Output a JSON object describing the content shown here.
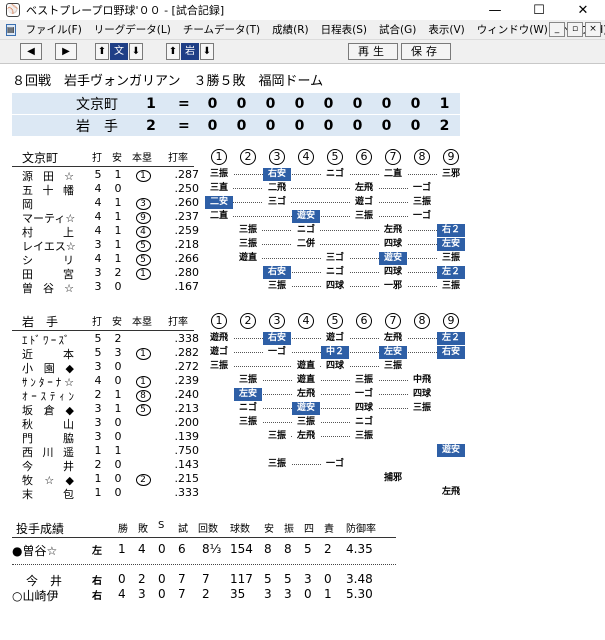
{
  "window": {
    "title": "ベストプレープロ野球'００ - [試合記録]",
    "controls": [
      "—",
      "☐",
      "✕"
    ]
  },
  "menu": {
    "items": [
      "ファイル(F)",
      "リーグデータ(L)",
      "チームデータ(T)",
      "成績(R)",
      "日程表(S)",
      "試合(G)",
      "表示(V)",
      "ウィンドウ(W)",
      "ヘルプ(H)"
    ],
    "mdi_controls": [
      "_",
      "▫",
      "×"
    ]
  },
  "toolbar": {
    "left_arrow": "◀",
    "right_arrow": "▶",
    "up1": "⬆",
    "team1": "文",
    "down1": "⬇",
    "up2": "⬆",
    "team2": "岩",
    "down2": "⬇",
    "replay": "再生",
    "save": "保存"
  },
  "game": {
    "title": "８回戦　岩手ヴォンガリアン　３勝５敗　福岡ドーム"
  },
  "scoreboard": [
    {
      "team": "文京町",
      "total": "1",
      "eq": "=",
      "innings": [
        "0",
        "0",
        "0",
        "0",
        "0",
        "0",
        "0",
        "0",
        "1"
      ]
    },
    {
      "team": "岩　手",
      "total": "2",
      "eq": "=",
      "innings": [
        "0",
        "0",
        "0",
        "0",
        "0",
        "0",
        "0",
        "0",
        "2"
      ]
    }
  ],
  "headers": {
    "ab": "打",
    "h": "安",
    "rbi": "本塁",
    "avg": "打率",
    "innings": [
      "1",
      "2",
      "3",
      "4",
      "5",
      "6",
      "7",
      "8",
      "9"
    ]
  },
  "visitor": {
    "team": "文京町",
    "batters": [
      {
        "name": "源田☆",
        "ab": "5",
        "h": "1",
        "rbi": "1",
        "avg": ".287",
        "cells": [
          [
            0,
            "三振",
            false
          ],
          [
            2,
            "右安",
            true
          ],
          [
            4,
            "ニゴ",
            false
          ],
          [
            6,
            "二直",
            false
          ],
          [
            8,
            "三邪",
            false
          ]
        ]
      },
      {
        "name": "五十幡",
        "ab": "4",
        "h": "0",
        "rbi": "",
        "avg": ".250",
        "cells": [
          [
            0,
            "三直",
            false
          ],
          [
            2,
            "二飛",
            false
          ],
          [
            5,
            "左飛",
            false
          ],
          [
            7,
            "一ゴ",
            false
          ]
        ]
      },
      {
        "name": "岡",
        "ab": "4",
        "h": "1",
        "rbi": "3",
        "avg": ".260",
        "cells": [
          [
            0,
            "二安",
            true
          ],
          [
            2,
            "三ゴ",
            false
          ],
          [
            5,
            "遊ゴ",
            false
          ],
          [
            7,
            "三振",
            false
          ]
        ]
      },
      {
        "name": "マーティ☆",
        "ab": "4",
        "h": "1",
        "rbi": "9",
        "avg": ".237",
        "cells": [
          [
            0,
            "二直",
            false
          ],
          [
            3,
            "遊安",
            true
          ],
          [
            5,
            "三振",
            false
          ],
          [
            7,
            "一ゴ",
            false
          ]
        ]
      },
      {
        "name": "村　上",
        "ab": "4",
        "h": "1",
        "rbi": "4",
        "avg": ".259",
        "cells": [
          [
            1,
            "三振",
            false
          ],
          [
            3,
            "ニゴ",
            false
          ],
          [
            6,
            "左飛",
            false
          ],
          [
            8,
            "右２",
            true
          ]
        ]
      },
      {
        "name": "レイエス☆",
        "ab": "3",
        "h": "1",
        "rbi": "5",
        "avg": ".218",
        "cells": [
          [
            1,
            "三振",
            false
          ],
          [
            3,
            "二併",
            false
          ],
          [
            6,
            "四球",
            false
          ],
          [
            8,
            "左安",
            true
          ]
        ]
      },
      {
        "name": "シ　リ",
        "ab": "4",
        "h": "1",
        "rbi": "5",
        "avg": ".266",
        "cells": [
          [
            1,
            "遊直",
            false
          ],
          [
            4,
            "三ゴ",
            false
          ],
          [
            6,
            "遊安",
            true
          ],
          [
            8,
            "三振",
            false
          ]
        ]
      },
      {
        "name": "田　宮",
        "ab": "3",
        "h": "2",
        "rbi": "1",
        "avg": ".280",
        "cells": [
          [
            2,
            "右安",
            true
          ],
          [
            4,
            "ニゴ",
            false
          ],
          [
            6,
            "四球",
            false
          ],
          [
            8,
            "左２",
            true
          ]
        ]
      },
      {
        "name": "曽谷☆",
        "ab": "3",
        "h": "0",
        "rbi": "",
        "avg": ".167",
        "cells": [
          [
            2,
            "三振",
            false
          ],
          [
            4,
            "四球",
            false
          ],
          [
            6,
            "一邪",
            false
          ],
          [
            8,
            "三振",
            false
          ]
        ]
      }
    ]
  },
  "home": {
    "team": "岩　手",
    "batters": [
      {
        "name": "ｴﾄﾞﾜｰｽﾞ",
        "ab": "5",
        "h": "2",
        "rbi": "",
        "avg": ".338",
        "cells": [
          [
            0,
            "遊飛",
            false
          ],
          [
            2,
            "右安",
            true
          ],
          [
            4,
            "遊ゴ",
            false
          ],
          [
            6,
            "左飛",
            false
          ],
          [
            8,
            "左２",
            true
          ]
        ]
      },
      {
        "name": "近　本",
        "ab": "5",
        "h": "3",
        "rbi": "1",
        "avg": ".282",
        "cells": [
          [
            0,
            "遊ゴ",
            false
          ],
          [
            2,
            "一ゴ",
            false
          ],
          [
            4,
            "中２",
            true
          ],
          [
            6,
            "左安",
            true
          ],
          [
            8,
            "右安",
            true
          ]
        ]
      },
      {
        "name": "小園◆",
        "ab": "3",
        "h": "0",
        "rbi": "",
        "avg": ".272",
        "cells": [
          [
            0,
            "三振",
            false
          ],
          [
            3,
            "遊直",
            false
          ],
          [
            4,
            "四球",
            false
          ],
          [
            6,
            "三振",
            false
          ]
        ]
      },
      {
        "name": "ｻﾝﾀｰﾅ☆",
        "ab": "4",
        "h": "0",
        "rbi": "1",
        "avg": ".239",
        "cells": [
          [
            1,
            "三振",
            false
          ],
          [
            3,
            "遊直",
            false
          ],
          [
            5,
            "三振",
            false
          ],
          [
            7,
            "中飛",
            false
          ]
        ]
      },
      {
        "name": "ｵｰｽﾃｨﾝ",
        "ab": "2",
        "h": "1",
        "rbi": "8",
        "avg": ".240",
        "cells": [
          [
            1,
            "左安",
            true
          ],
          [
            3,
            "左飛",
            false
          ],
          [
            5,
            "一ゴ",
            false
          ],
          [
            7,
            "四球",
            false
          ]
        ]
      },
      {
        "name": "坂倉◆",
        "ab": "3",
        "h": "1",
        "rbi": "5",
        "avg": ".213",
        "cells": [
          [
            1,
            "ニゴ",
            false
          ],
          [
            3,
            "遊安",
            true
          ],
          [
            5,
            "四球",
            false
          ],
          [
            7,
            "三振",
            false
          ]
        ]
      },
      {
        "name": "秋　山",
        "ab": "3",
        "h": "0",
        "rbi": "",
        "avg": ".200",
        "cells": [
          [
            1,
            "三振",
            false
          ],
          [
            3,
            "三振",
            false
          ],
          [
            5,
            "ニゴ",
            false
          ]
        ]
      },
      {
        "name": "門　脇",
        "ab": "3",
        "h": "0",
        "rbi": "",
        "avg": ".139",
        "cells": [
          [
            2,
            "三振",
            false
          ],
          [
            3,
            "左飛",
            false
          ],
          [
            5,
            "三振",
            false
          ]
        ]
      },
      {
        "name": "西川遥",
        "ab": "1",
        "h": "1",
        "rbi": "",
        "avg": ".750",
        "cells": [
          [
            8,
            "遊安",
            true
          ]
        ]
      },
      {
        "name": "今　井",
        "ab": "2",
        "h": "0",
        "rbi": "",
        "avg": ".143",
        "cells": [
          [
            2,
            "三振",
            false
          ],
          [
            4,
            "一ゴ",
            false
          ]
        ]
      },
      {
        "name": "牧☆◆",
        "ab": "1",
        "h": "0",
        "rbi": "2",
        "avg": ".215",
        "cells": [
          [
            6,
            "捕邪",
            false
          ]
        ]
      },
      {
        "name": "末　包",
        "ab": "1",
        "h": "0",
        "rbi": "",
        "avg": ".333",
        "cells": [
          [
            8,
            "左飛",
            false
          ]
        ]
      }
    ]
  },
  "pitching": {
    "title": "投手成績",
    "headers": [
      "勝",
      "敗",
      "S",
      "試",
      "回数",
      "球数",
      "安",
      "振",
      "四",
      "責",
      "防御率"
    ],
    "visitor": [
      {
        "mark": "●",
        "name": "曽谷☆",
        "hand": "左",
        "w": "1",
        "l": "4",
        "s": "0",
        "g": "6",
        "ip": "8⅓",
        "np": "154",
        "h": "8",
        "so": "8",
        "bb": "5",
        "er": "2",
        "era": "4.35"
      }
    ],
    "home": [
      {
        "mark": "",
        "name": "今　井",
        "hand": "右",
        "w": "0",
        "l": "2",
        "s": "0",
        "g": "7",
        "ip": "7",
        "np": "117",
        "h": "5",
        "so": "5",
        "bb": "3",
        "er": "0",
        "era": "3.48"
      },
      {
        "mark": "○",
        "name": "山崎伊",
        "hand": "右",
        "w": "4",
        "l": "3",
        "s": "0",
        "g": "7",
        "ip": "2",
        "np": "35",
        "h": "3",
        "so": "3",
        "bb": "0",
        "er": "1",
        "era": "5.30"
      }
    ]
  }
}
